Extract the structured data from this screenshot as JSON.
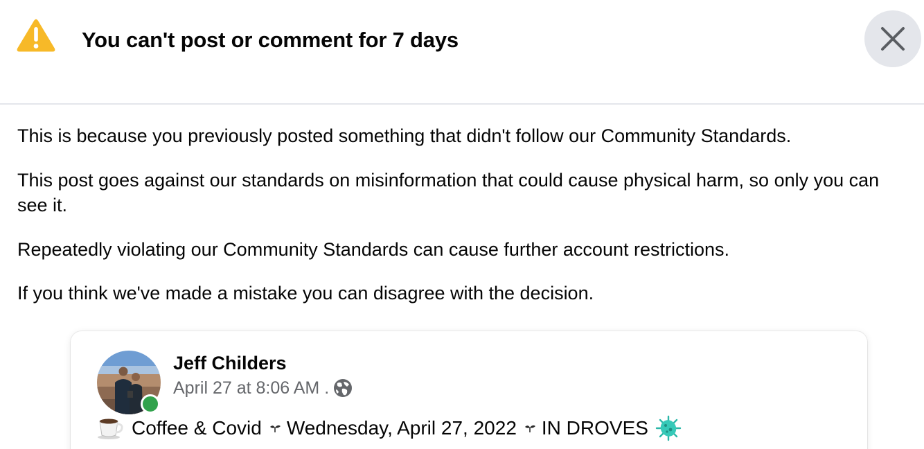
{
  "dialog": {
    "title": "You can't post or comment for 7 days",
    "icons": {
      "warning": "warning-triangle-icon",
      "close": "close-icon"
    }
  },
  "body": {
    "paragraph_1": "This is because you previously posted something that didn't follow our Community Standards.",
    "paragraph_2": "This post goes against our standards on misinformation that could cause physical harm, so only you can see it.",
    "paragraph_3": "Repeatedly violating our Community Standards can cause further account restrictions.",
    "paragraph_4": "If you think we've made a mistake you can disagree with the decision."
  },
  "post": {
    "author": "Jeff Childers",
    "timestamp": "April 27 at 8:06 AM",
    "meta_separator": ".",
    "audience_icon": "globe-icon",
    "text_part_1": "Coffee & Covid",
    "text_part_2": "Wednesday, April 27, 2022",
    "text_part_3": "IN DROVES",
    "icons": [
      "coffee-cup-icon",
      "seedling-icon",
      "virus-icon"
    ]
  },
  "colors": {
    "warning": "#f7b928",
    "close_bg": "#e4e6eb",
    "secondary_text": "#65676b",
    "online": "#31a24c",
    "divider": "#e4e6eb"
  }
}
